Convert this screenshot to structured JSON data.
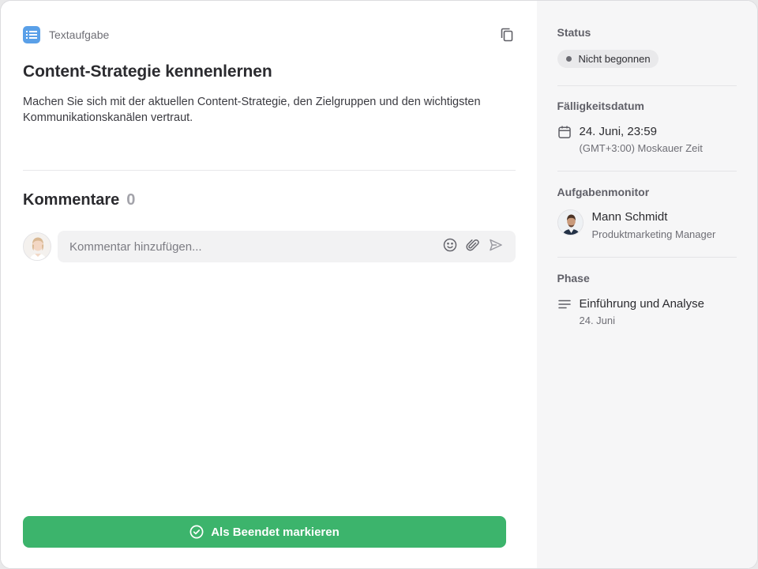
{
  "task": {
    "type_label": "Textaufgabe",
    "title": "Content-Strategie kennenlernen",
    "description": "Machen Sie sich mit der aktuellen Content-Strategie, den Zielgruppen und den wichtigsten Kommunikationskanälen vertraut."
  },
  "comments": {
    "heading": "Kommentare",
    "count": "0",
    "placeholder": "Kommentar hinzufügen..."
  },
  "actions": {
    "mark_done_label": "Als Beendet markieren"
  },
  "sidebar": {
    "status": {
      "label": "Status",
      "value": "Nicht begonnen"
    },
    "due": {
      "label": "Fälligkeitsdatum",
      "date": "24. Juni, 23:59",
      "timezone": "(GMT+3:00) Moskauer Zeit"
    },
    "monitor": {
      "label": "Aufgabenmonitor",
      "name": "Mann Schmidt",
      "role": "Produktmarketing Manager"
    },
    "phase": {
      "label": "Phase",
      "name": "Einführung und Analyse",
      "date": "24. Juni"
    }
  },
  "icons": {
    "task_type": "list-icon",
    "copy": "copy-icon",
    "emoji": "smiley-icon",
    "attach": "paperclip-icon",
    "send": "send-icon",
    "check": "check-circle-icon",
    "calendar": "calendar-icon",
    "phase": "lines-icon"
  },
  "colors": {
    "accent_green": "#3cb46c",
    "type_blue": "#5aa0e8",
    "sidebar_bg": "#f6f6f7"
  }
}
